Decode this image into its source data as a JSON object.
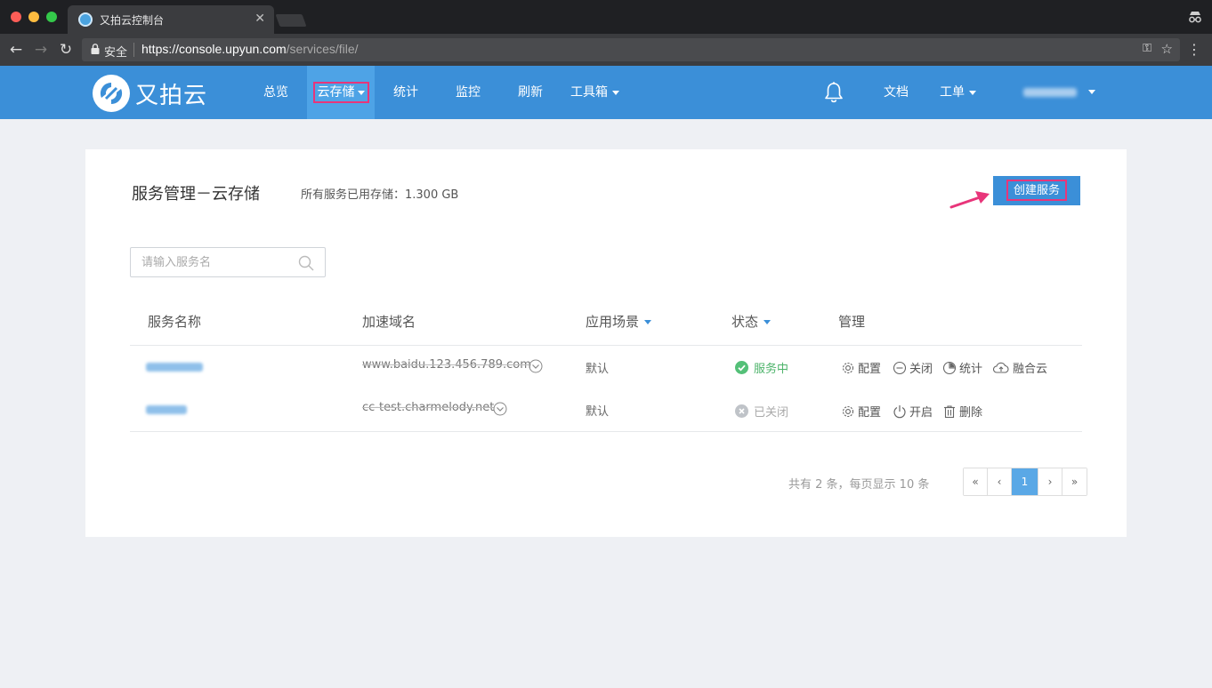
{
  "browser": {
    "tab_title": "又拍云控制台",
    "tab_close": "✕",
    "secure_label": "安全",
    "url_base": "https://console.upyun.com",
    "url_path": "/services/file/"
  },
  "header": {
    "logo_text": "又拍云",
    "nav": [
      {
        "label": "总览"
      },
      {
        "label": "云存储"
      },
      {
        "label": "统计"
      },
      {
        "label": "监控"
      },
      {
        "label": "刷新"
      },
      {
        "label": "工具箱"
      }
    ],
    "docs_label": "文档",
    "ticket_label": "工单"
  },
  "page": {
    "title": "服务管理－云存储",
    "storage_summary": "所有服务已用存储：1.300 GB",
    "create_button": "创建服务",
    "search_placeholder": "请输入服务名"
  },
  "table": {
    "headers": {
      "name": "服务名称",
      "domain": "加速域名",
      "scenario": "应用场景",
      "status": "状态",
      "manage": "管理"
    },
    "rows": [
      {
        "domain": "www.baidu.123.456.789.com",
        "scenario": "默认",
        "status": "服务中",
        "actions": [
          "配置",
          "关闭",
          "统计",
          "融合云"
        ]
      },
      {
        "domain": "cc-test.charmelody.net",
        "scenario": "默认",
        "status": "已关闭",
        "actions": [
          "配置",
          "开启",
          "删除"
        ]
      }
    ]
  },
  "pagination": {
    "info": "共有 2 条，每页显示 10 条",
    "first": "«",
    "prev": "‹",
    "current": "1",
    "next": "›",
    "last": "»"
  },
  "colors": {
    "brand": "#3b8fd8",
    "highlight": "#e8357a",
    "status_on": "#54c078",
    "status_off": "#bfc3c8"
  }
}
